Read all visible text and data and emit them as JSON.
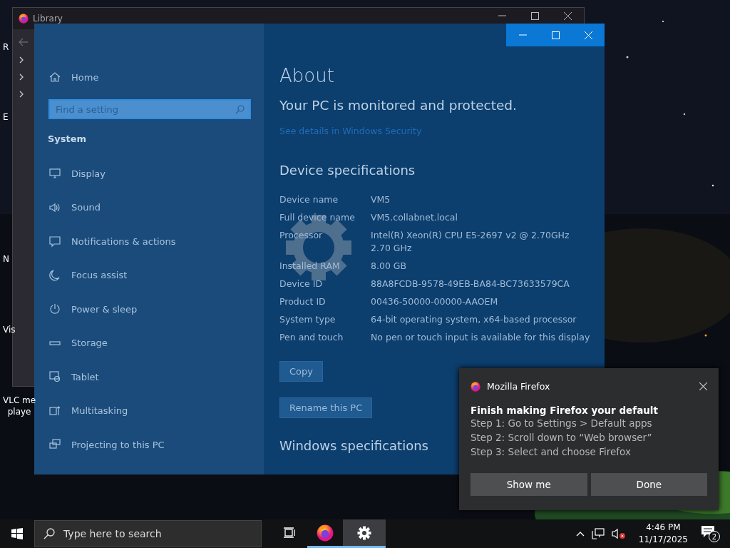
{
  "desktop_icons": [
    {
      "label": "R"
    },
    {
      "label": "E"
    },
    {
      "label": "N"
    },
    {
      "label": "Vis"
    },
    {
      "label": "VLC me\nplaye"
    }
  ],
  "library_window": {
    "title": "Library"
  },
  "settings_window": {
    "nav": {
      "home": "Home",
      "search": {
        "placeholder": "Find a setting"
      },
      "section": "System",
      "items": [
        {
          "label": "Display"
        },
        {
          "label": "Sound"
        },
        {
          "label": "Notifications & actions"
        },
        {
          "label": "Focus assist"
        },
        {
          "label": "Power & sleep"
        },
        {
          "label": "Storage"
        },
        {
          "label": "Tablet"
        },
        {
          "label": "Multitasking"
        },
        {
          "label": "Projecting to this PC"
        }
      ]
    },
    "page": {
      "title": "About",
      "status": "Your PC is monitored and protected.",
      "link": "See details in Windows Security",
      "section": "Device specifications",
      "specs": [
        {
          "label": "Device name",
          "value": "VM5"
        },
        {
          "label": "Full device name",
          "value": "VM5.collabnet.local"
        },
        {
          "label": "Processor",
          "value": "Intel(R) Xeon(R) CPU E5-2697 v2 @ 2.70GHz\n2.70 GHz"
        },
        {
          "label": "Installed RAM",
          "value": "8.00 GB"
        },
        {
          "label": "Device ID",
          "value": "88A8FCDB-9578-49EB-BA84-BC73633579CA"
        },
        {
          "label": "Product ID",
          "value": "00436-50000-00000-AAOEM"
        },
        {
          "label": "System type",
          "value": "64-bit operating system, x64-based processor"
        },
        {
          "label": "Pen and touch",
          "value": "No pen or touch input is available for this display"
        }
      ],
      "buttons": [
        "Copy",
        "Rename this PC"
      ],
      "next_section": "Windows specifications"
    }
  },
  "toast": {
    "app": "Mozilla Firefox",
    "title": "Finish making Firefox your default",
    "lines": [
      "Step 1: Go to Settings > Default apps",
      "Step 2: Scroll down to “Web browser”",
      "Step 3: Select and choose Firefox"
    ],
    "buttons": [
      "Show me",
      "Done"
    ]
  },
  "taskbar": {
    "search": {
      "placeholder": "Type here to search"
    },
    "apps": [
      {
        "kind": "taskview",
        "selected": false
      },
      {
        "kind": "firefox",
        "selected": false
      },
      {
        "kind": "settings",
        "selected": true
      }
    ],
    "time": "4:46 PM",
    "date": "11/17/2025",
    "notifications": "2"
  }
}
